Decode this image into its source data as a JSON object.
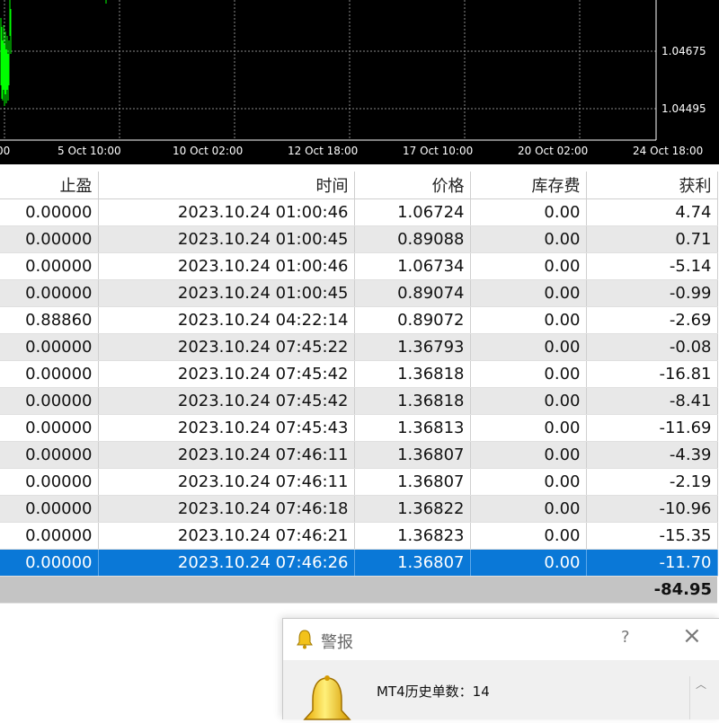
{
  "chart": {
    "price_labels": [
      "1.04675",
      "1.04495"
    ],
    "time_labels": [
      "00",
      "5 Oct 10:00",
      "10 Oct 02:00",
      "12 Oct 18:00",
      "17 Oct 10:00",
      "20 Oct 02:00",
      "24 Oct 18:00"
    ],
    "colors": {
      "background": "#000000",
      "grid": "#8a8a8a",
      "candle": "#00ff00",
      "axis": "#ffffff"
    }
  },
  "table": {
    "columns": [
      "止盈",
      "时间",
      "价格",
      "库存费",
      "获利"
    ],
    "rows": [
      [
        "0.00000",
        "2023.10.24 01:00:46",
        "1.06724",
        "0.00",
        "4.74"
      ],
      [
        "0.00000",
        "2023.10.24 01:00:45",
        "0.89088",
        "0.00",
        "0.71"
      ],
      [
        "0.00000",
        "2023.10.24 01:00:46",
        "1.06734",
        "0.00",
        "-5.14"
      ],
      [
        "0.00000",
        "2023.10.24 01:00:45",
        "0.89074",
        "0.00",
        "-0.99"
      ],
      [
        "0.88860",
        "2023.10.24 04:22:14",
        "0.89072",
        "0.00",
        "-2.69"
      ],
      [
        "0.00000",
        "2023.10.24 07:45:22",
        "1.36793",
        "0.00",
        "-0.08"
      ],
      [
        "0.00000",
        "2023.10.24 07:45:42",
        "1.36818",
        "0.00",
        "-16.81"
      ],
      [
        "0.00000",
        "2023.10.24 07:45:42",
        "1.36818",
        "0.00",
        "-8.41"
      ],
      [
        "0.00000",
        "2023.10.24 07:45:43",
        "1.36813",
        "0.00",
        "-11.69"
      ],
      [
        "0.00000",
        "2023.10.24 07:46:11",
        "1.36807",
        "0.00",
        "-4.39"
      ],
      [
        "0.00000",
        "2023.10.24 07:46:11",
        "1.36807",
        "0.00",
        "-2.19"
      ],
      [
        "0.00000",
        "2023.10.24 07:46:18",
        "1.36822",
        "0.00",
        "-10.96"
      ],
      [
        "0.00000",
        "2023.10.24 07:46:21",
        "1.36823",
        "0.00",
        "-15.35"
      ],
      [
        "0.00000",
        "2023.10.24 07:46:26",
        "1.36807",
        "0.00",
        "-11.70"
      ]
    ],
    "selected_row_index": 13,
    "total_profit": "-84.95",
    "colors": {
      "row_even": "#e8e8e8",
      "row_odd": "#ffffff",
      "selected": "#0a78d7",
      "total_row": "#c4c4c4"
    }
  },
  "alert": {
    "title": "警报",
    "help_label": "?",
    "close_label": "×",
    "message": "MT4历史单数：14",
    "icons": {
      "title": "bell-icon",
      "body": "bell-icon"
    }
  }
}
